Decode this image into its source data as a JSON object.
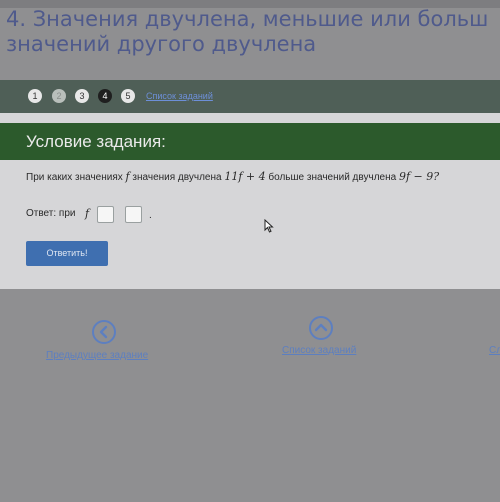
{
  "heading": {
    "line1": "4. Значения двучлена, меньшие или больш",
    "line2": "значений другого двучлена"
  },
  "steps": [
    {
      "label": "1",
      "state": "done"
    },
    {
      "label": "2",
      "state": "faded"
    },
    {
      "label": "3",
      "state": "done"
    },
    {
      "label": "4",
      "state": "active"
    },
    {
      "label": "5",
      "state": "done"
    }
  ],
  "steps_link": "Список заданий",
  "card": {
    "title": "Условие задания:",
    "question": {
      "prefix": "При каких значениях",
      "var": "f",
      "middle": "значения двучлена",
      "expr1": "11f + 4",
      "suffix": "больше значений двучлена",
      "expr2": "9f − 9?"
    },
    "answer": {
      "label": "Ответ: при",
      "var": "f",
      "end": "."
    },
    "submit_label": "Ответить!"
  },
  "bottom_nav": {
    "prev_label": "Предыдущее задание",
    "list_label": "Список заданий",
    "next_label": "Сл"
  },
  "colors": {
    "progress_bg": "#4f5f57",
    "card_header": "#2c5a2c",
    "submit_bg": "#3f6fb0",
    "link": "#5d7fc0"
  }
}
